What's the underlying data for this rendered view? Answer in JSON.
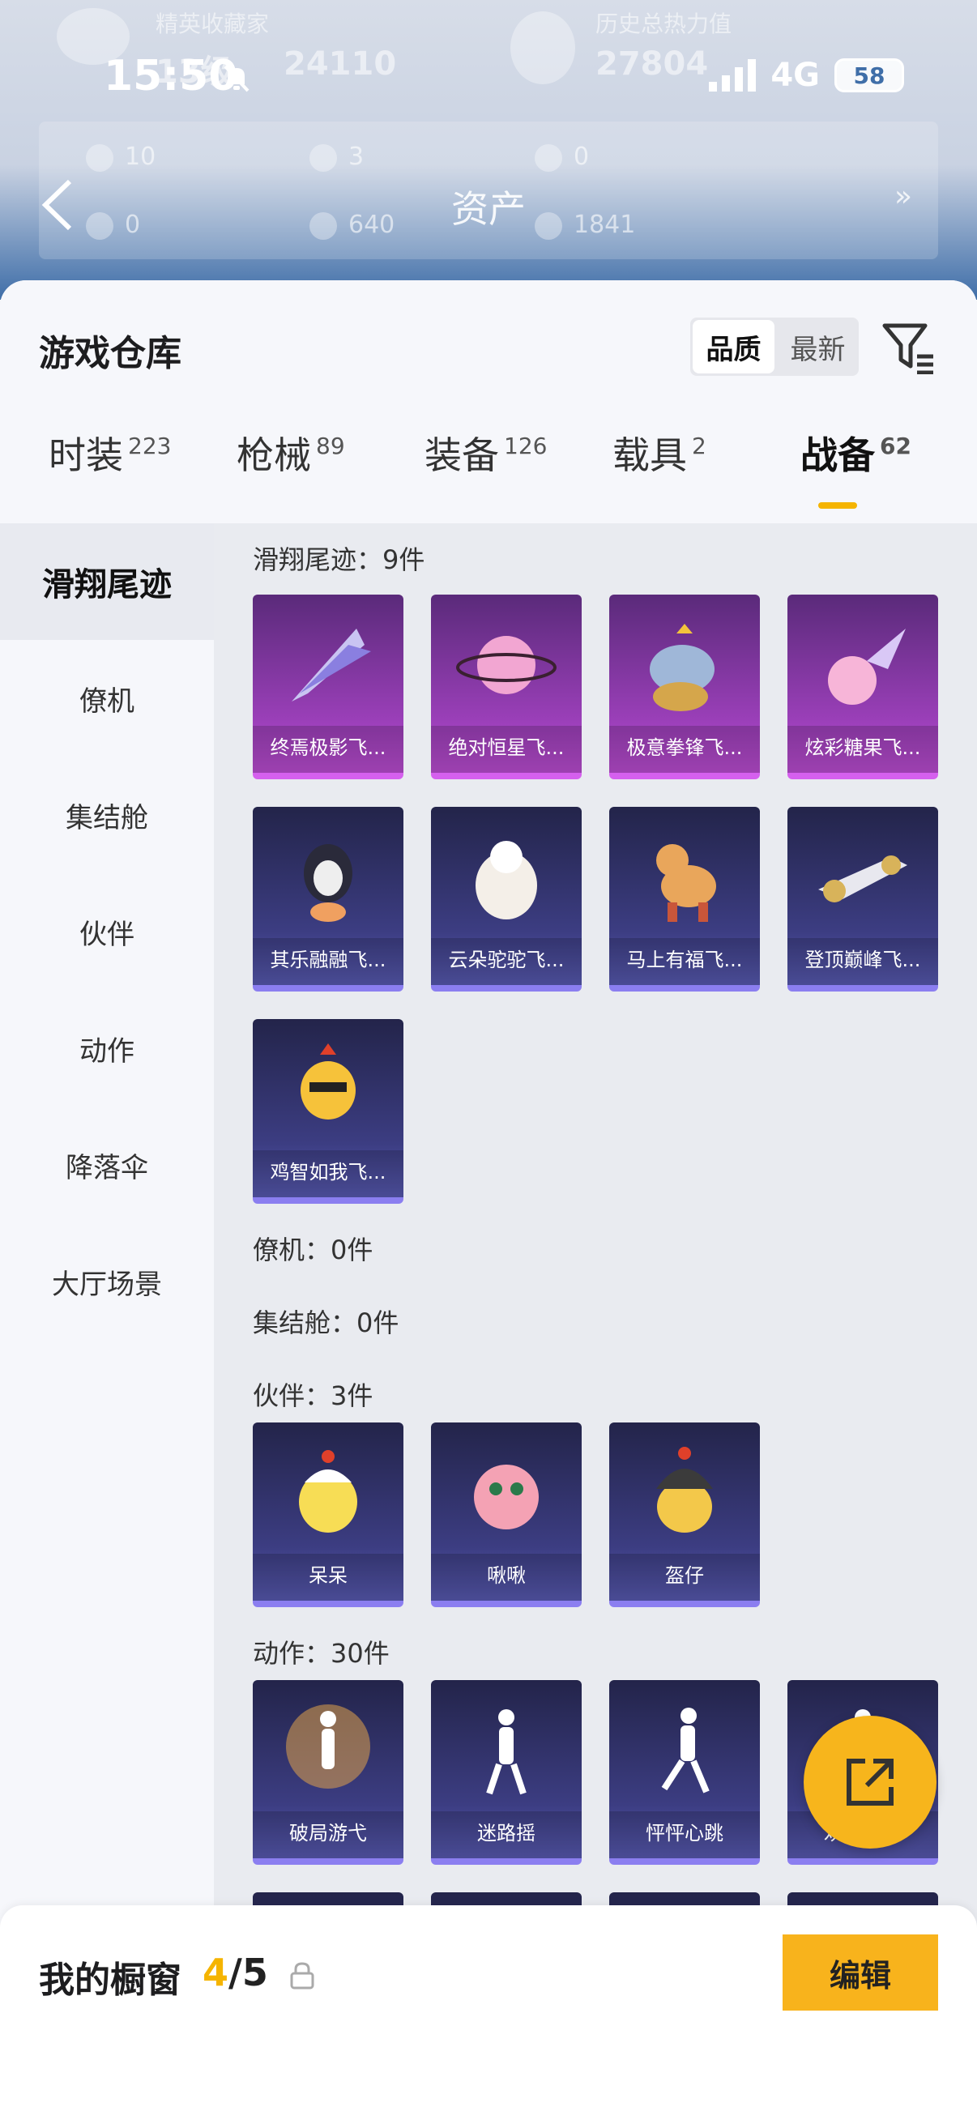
{
  "status_bar": {
    "time": "15:50",
    "network": "4G",
    "battery": "58"
  },
  "banner": {
    "title": "资产",
    "ghost_collector": "精英收藏家",
    "ghost_level": "13级",
    "ghost_points": "24110",
    "ghost_heat_label": "历史总热力值",
    "ghost_heat_value": "27804",
    "assets": [
      "10",
      "3",
      "0",
      "0",
      "640",
      "1841"
    ]
  },
  "sheet": {
    "title": "游戏仓库",
    "sort_options": [
      "品质",
      "最新"
    ],
    "tabs": [
      {
        "label": "时装",
        "count": "223"
      },
      {
        "label": "枪械",
        "count": "89"
      },
      {
        "label": "装备",
        "count": "126"
      },
      {
        "label": "载具",
        "count": "2"
      },
      {
        "label": "战备",
        "count": "62"
      }
    ]
  },
  "categories": [
    "滑翔尾迹",
    "僚机",
    "集结舱",
    "伙伴",
    "动作",
    "降落伞",
    "大厅场景"
  ],
  "sections": {
    "glide": {
      "label": "滑翔尾迹：9件",
      "items": [
        "终焉极影飞...",
        "绝对恒星飞...",
        "极意拳锋飞...",
        "炫彩糖果飞...",
        "其乐融融飞...",
        "云朵驼驼飞...",
        "马上有福飞...",
        "登顶巅峰飞...",
        "鸡智如我飞..."
      ]
    },
    "wingman": {
      "label": "僚机：0件"
    },
    "capsule": {
      "label": "集结舱：0件"
    },
    "partner": {
      "label": "伙伴：3件",
      "items": [
        "呆呆",
        "啾啾",
        "盔仔"
      ]
    },
    "emote": {
      "label": "动作：30件",
      "items": [
        "破局游弋",
        "迷路摇",
        "怦怦心跳",
        "欢跃舞步"
      ]
    }
  },
  "bottom": {
    "label": "我的橱窗",
    "current": "4",
    "total": "/5",
    "edit_label": "编辑"
  },
  "colors": {
    "accent": "#f5b400",
    "purple_card": "#9a3fb8",
    "blue_card": "#3c3d82"
  }
}
